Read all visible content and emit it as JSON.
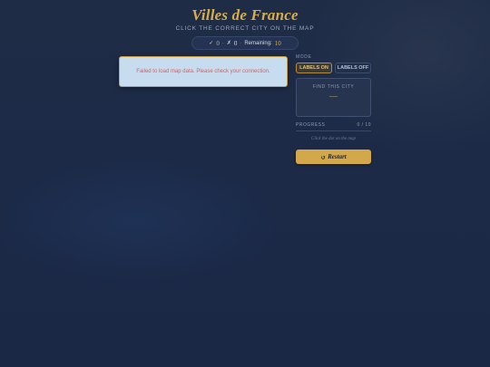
{
  "header": {
    "title": "Villes de France",
    "subtitle": "CLICK THE CORRECT CITY ON THE MAP"
  },
  "score": {
    "correct_icon": "✓",
    "correct": "0",
    "wrong_icon": "✗",
    "wrong": "0",
    "remaining_label": "Remaining:",
    "remaining": "10"
  },
  "error": {
    "message": "Failed to load map data. Please check your connection."
  },
  "panel": {
    "mode_label": "MODE",
    "labels_on": "LABELS ON",
    "labels_off": "LABELS OFF",
    "active_mode": "on",
    "find_label": "FIND THIS CITY",
    "city": "—",
    "progress_label": "PROGRESS",
    "progress_text": "0 / 10",
    "progress_fraction": 0,
    "hint": "Click the dot on the map",
    "restart_icon": "↺",
    "restart_label": "Restart"
  },
  "colors": {
    "accent": "#d9ae4a",
    "background": "#1c2a48",
    "error_text": "#d95f5f",
    "error_bg": "#c7dcef"
  }
}
